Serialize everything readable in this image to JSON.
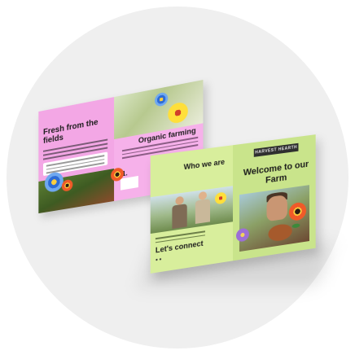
{
  "brochure_left": {
    "title": "Fresh from the fields",
    "heading": "Organic farming",
    "step_number": "1."
  },
  "brochure_right": {
    "who_we_are": "Who we are",
    "lets_connect": "Let's connect",
    "logo_text": "HARVEST HEARTH",
    "welcome": "Welcome to our Farm"
  },
  "colors": {
    "pink_panel": "#f3a7e5",
    "green_panel": "#d8ee9c",
    "background_disc": "#efefef"
  }
}
